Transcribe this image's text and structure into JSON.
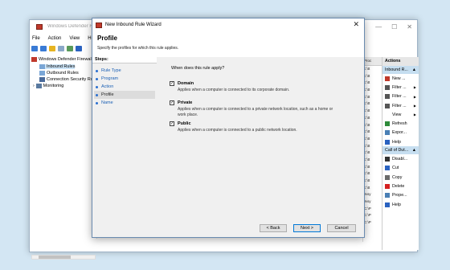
{
  "main_window": {
    "title": "Windows Defender Firewall with Advanced Security",
    "controls": [
      "—",
      "☐",
      "✕"
    ],
    "menu": [
      "File",
      "Action",
      "View",
      "Help"
    ],
    "tree": [
      {
        "label": "Windows Defender Firewall",
        "indent": 0
      },
      {
        "label": "Inbound Rules",
        "indent": 1
      },
      {
        "label": "Outbound Rules",
        "indent": 1
      },
      {
        "label": "Connection Security Rules",
        "indent": 1
      },
      {
        "label": "Monitoring",
        "indent": 1
      }
    ],
    "middle_header": "Proc",
    "middle_rows": [
      "c:\\tt",
      "c:\\tt",
      "c:\\tt",
      "c:\\tt",
      "c:\\tt",
      "c:\\tt",
      "c:\\tt",
      "c:\\tt",
      "c:\\tt",
      "c:\\tt",
      "c:\\tt",
      "c:\\tt",
      "c:\\tt",
      "c:\\tt",
      "c:\\tt",
      "c:\\tt",
      "c:\\tt",
      "c:\\tt",
      "%sy",
      "%sy",
      "C:\\P",
      "C:\\P",
      "C:\\P"
    ]
  },
  "actions": {
    "header": "Actions",
    "section1": "Inbound R...",
    "items1": [
      {
        "label": "New ...",
        "icon": "new-rule-icon",
        "color": "#c0392b",
        "arrow": false
      },
      {
        "label": "Filter ...",
        "icon": "filter-icon",
        "color": "#555",
        "arrow": true
      },
      {
        "label": "Filter ...",
        "icon": "filter-icon",
        "color": "#555",
        "arrow": true
      },
      {
        "label": "Filter ...",
        "icon": "filter-icon",
        "color": "#555",
        "arrow": true
      },
      {
        "label": "View",
        "icon": "",
        "color": "",
        "arrow": true
      },
      {
        "label": "Refresh",
        "icon": "refresh-icon",
        "color": "#2e8b3a",
        "arrow": false
      },
      {
        "label": "Expor...",
        "icon": "export-icon",
        "color": "#4a7fb5",
        "arrow": false
      },
      {
        "label": "Help",
        "icon": "help-icon",
        "color": "#2a62c0",
        "arrow": false
      }
    ],
    "section2": "Call of Dut...",
    "items2": [
      {
        "label": "Disabl...",
        "icon": "disable-icon",
        "color": "#333",
        "arrow": false
      },
      {
        "label": "Cut",
        "icon": "cut-icon",
        "color": "#2a62c0",
        "arrow": false
      },
      {
        "label": "Copy",
        "icon": "copy-icon",
        "color": "#6a6a6a",
        "arrow": false
      },
      {
        "label": "Delete",
        "icon": "delete-icon",
        "color": "#d42020",
        "arrow": false
      },
      {
        "label": "Prope...",
        "icon": "properties-icon",
        "color": "#4a7fb5",
        "arrow": false
      },
      {
        "label": "Help",
        "icon": "help-icon",
        "color": "#2a62c0",
        "arrow": false
      }
    ]
  },
  "wizard": {
    "title": "New Inbound Rule Wizard",
    "heading": "Profile",
    "subheading": "Specify the profiles for which this rule applies.",
    "steps_label": "Steps:",
    "steps": [
      "Rule Type",
      "Program",
      "Action",
      "Profile",
      "Name"
    ],
    "current_step": "Profile",
    "question": "When does this rule apply?",
    "options": [
      {
        "name": "Domain",
        "checked": true,
        "desc": "Applies when a computer is connected to its corporate domain."
      },
      {
        "name": "Private",
        "checked": true,
        "desc": "Applies when a computer is connected to a private network location, such as a home or work place."
      },
      {
        "name": "Public",
        "checked": true,
        "desc": "Applies when a computer is connected to a public network location."
      }
    ],
    "buttons": {
      "back": "< Back",
      "next": "Next >",
      "cancel": "Cancel"
    },
    "close": "✕"
  }
}
